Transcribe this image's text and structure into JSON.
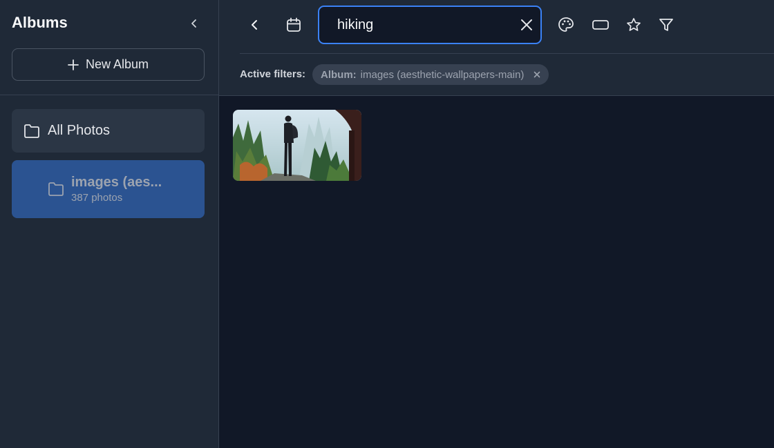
{
  "sidebar": {
    "title": "Albums",
    "new_album_label": "New Album",
    "albums": [
      {
        "label": "All Photos"
      },
      {
        "label": "images (aes...",
        "count": "387 photos"
      }
    ]
  },
  "toolbar": {
    "search_value": "hiking",
    "icons": [
      "back-icon",
      "calendar-icon",
      "search-icon",
      "close-icon",
      "palette-icon",
      "aspect-ratio-icon",
      "star-icon",
      "filter-icon"
    ]
  },
  "filters": {
    "label": "Active filters:",
    "chip_key": "Album:",
    "chip_value": "images (aesthetic-wallpapers-main)"
  },
  "colors": {
    "accent": "#3b82f6",
    "selected_album": "#2b5391",
    "background": "#111827",
    "panel": "#1f2937"
  }
}
